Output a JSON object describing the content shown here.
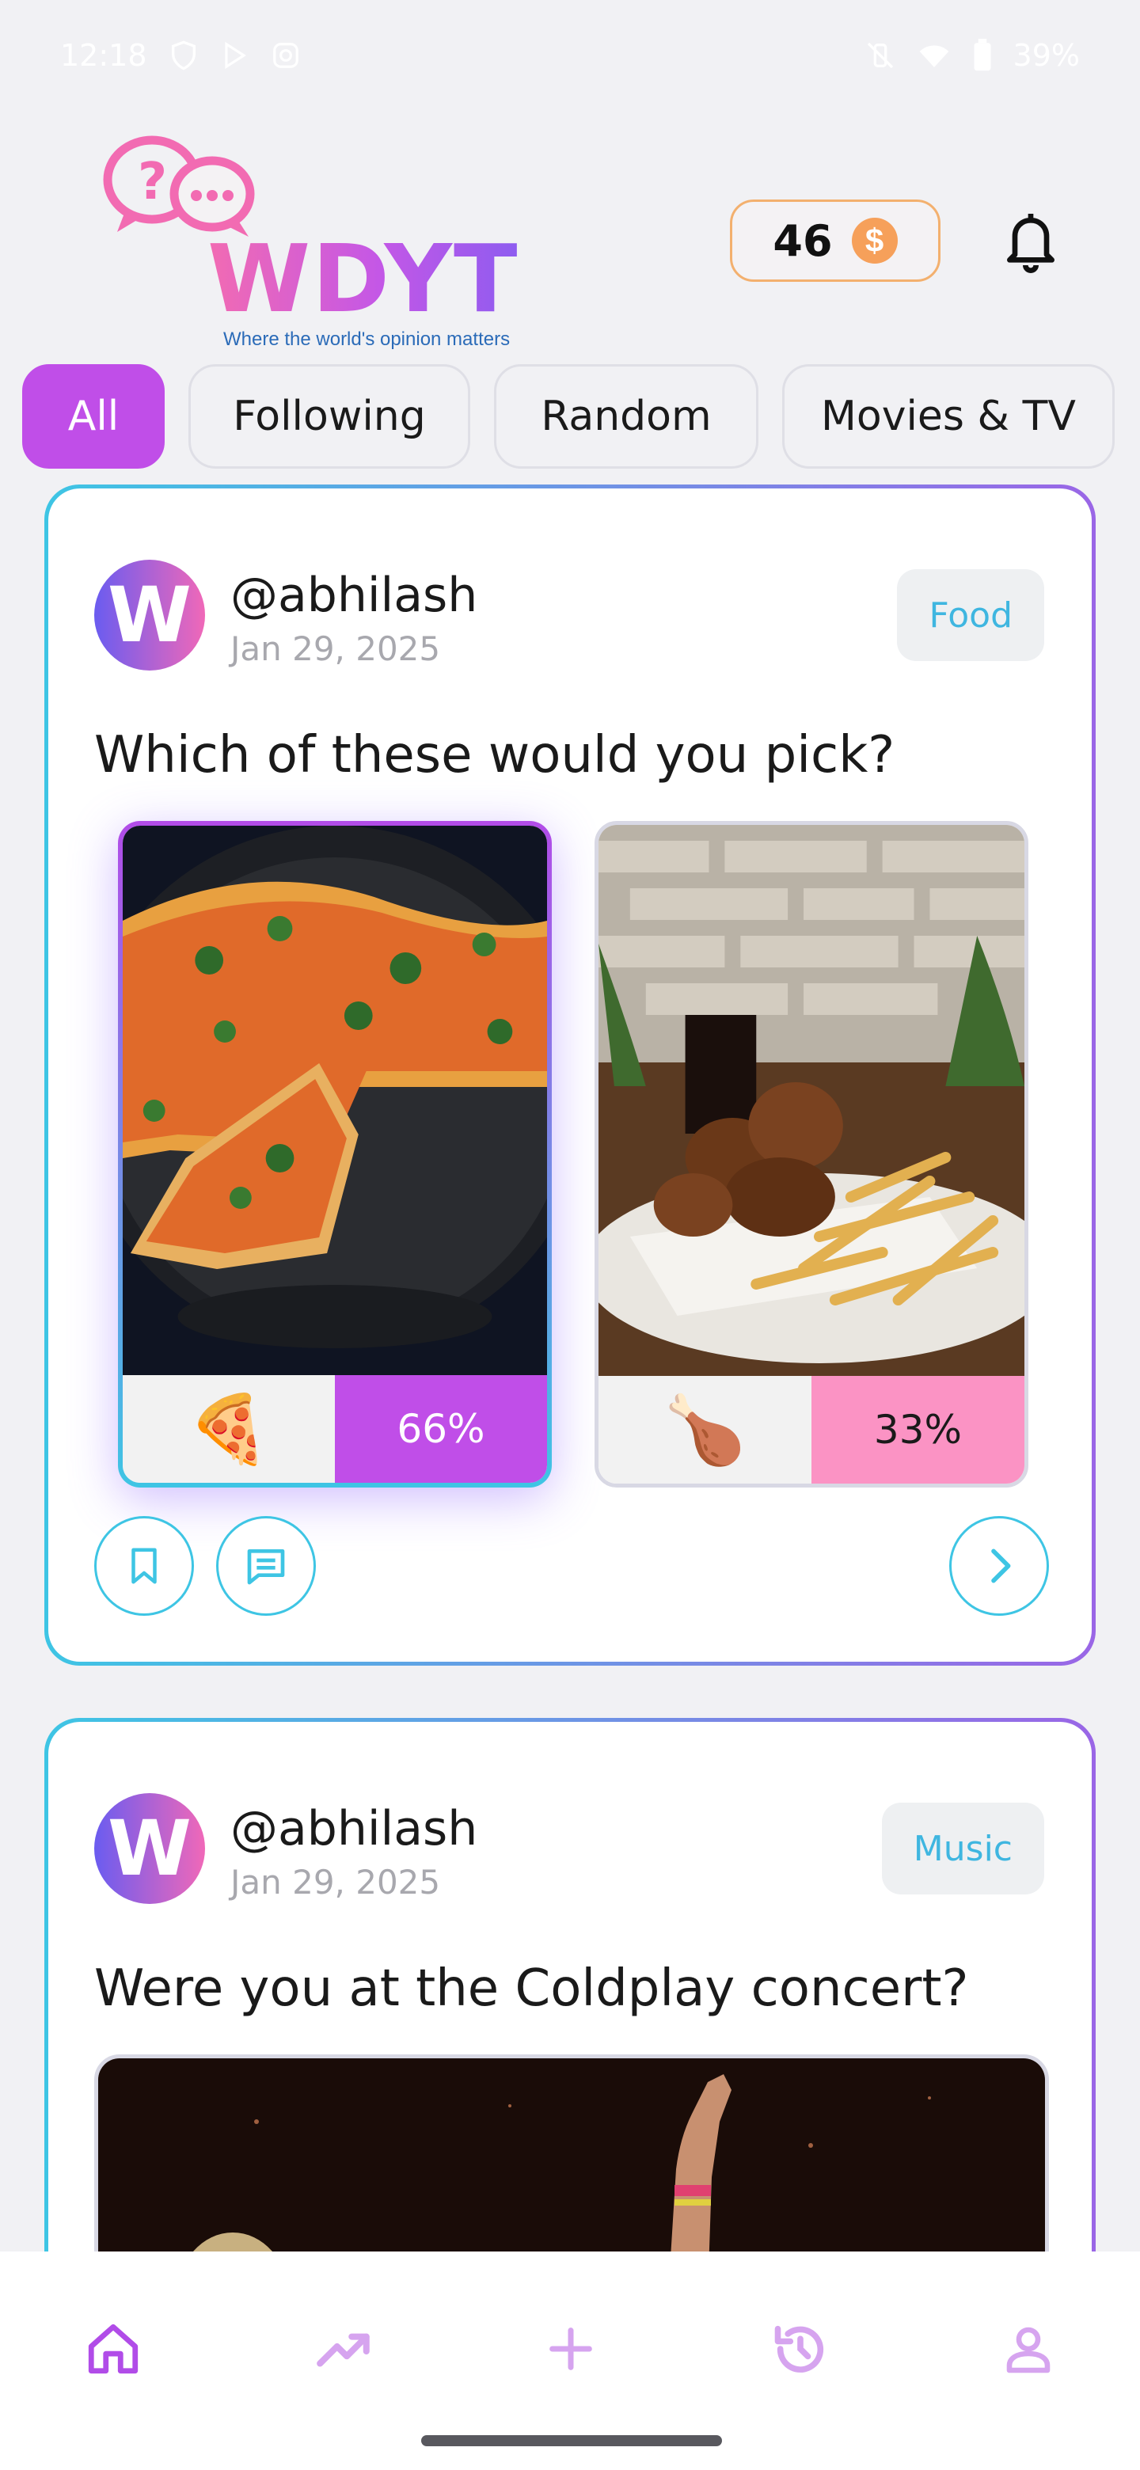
{
  "status_bar": {
    "time": "12:18",
    "battery": "39%"
  },
  "header": {
    "logo_text": "WDYT",
    "tagline": "Where the world's opinion matters",
    "coins": "46",
    "coin_symbol": "$"
  },
  "chips": [
    {
      "label": "All",
      "active": true
    },
    {
      "label": "Following",
      "active": false
    },
    {
      "label": "Random",
      "active": false
    },
    {
      "label": "Movies & TV",
      "active": false
    }
  ],
  "posts": [
    {
      "avatar_letter": "W",
      "username": "@abhilash",
      "date": "Jan 29, 2025",
      "category": "Food",
      "question": "Which of these would you pick?",
      "options": [
        {
          "emoji": "🍕",
          "percent": "66%",
          "selected": true,
          "image": "pizza-photo"
        },
        {
          "emoji": "🍗",
          "percent": "33%",
          "selected": false,
          "image": "fried-chicken-photo"
        }
      ]
    },
    {
      "avatar_letter": "W",
      "username": "@abhilash",
      "date": "Jan 29, 2025",
      "category": "Music",
      "question": "Were you at the Coldplay concert?",
      "image": "concert-photo"
    }
  ],
  "nav": [
    {
      "icon": "home-icon",
      "active": true
    },
    {
      "icon": "trending-icon",
      "active": false
    },
    {
      "icon": "plus-icon",
      "active": false
    },
    {
      "icon": "history-icon",
      "active": false
    },
    {
      "icon": "profile-icon",
      "active": false
    }
  ],
  "colors": {
    "accent": "#c04ee8",
    "cyan": "#3ec5e4",
    "pink": "#fb93c4",
    "coin": "#f6a05a"
  }
}
